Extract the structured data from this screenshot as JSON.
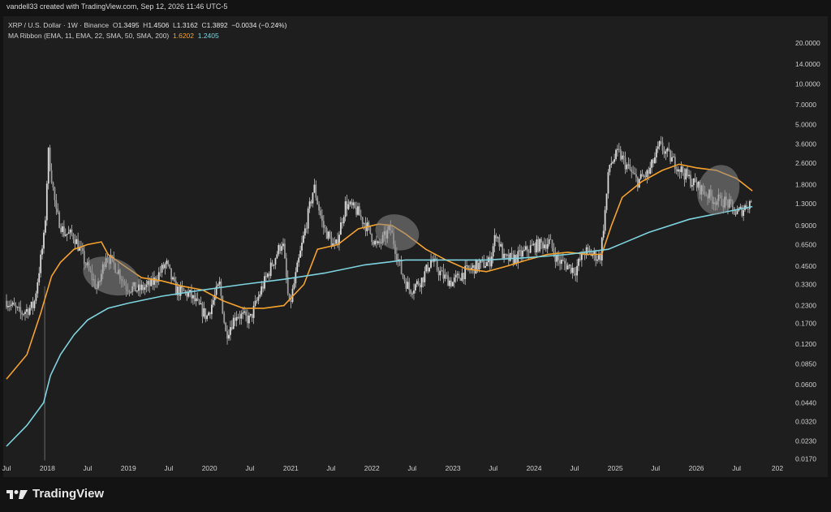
{
  "header": "vandell33 created with TradingView.com, Sep 12, 2026 11:46 UTC-5",
  "legend": {
    "symbol": "XRP / U.S. Dollar · 1W · Binance",
    "open_label": "O",
    "open": "1.3495",
    "high_label": "H",
    "high": "1.4506",
    "low_label": "L",
    "low": "1.3162",
    "close_label": "C",
    "close": "1.3892",
    "change": "−0.0034 (−0.24%)",
    "indicator": "MA Ribbon (EMA, 11, EMA, 22, SMA, 50, SMA, 200)",
    "ma1_value": "1.6202",
    "ma2_value": "1.2405"
  },
  "brand": "TradingView",
  "colors": {
    "ma_fast": "#f5a22d",
    "ma_slow": "#7ed3df",
    "candles": "#d9d9d9",
    "ellipse": "#8a8a8a"
  },
  "chart_data": {
    "type": "candlestick",
    "y_scale": "log",
    "ylim": [
      0.0155,
      24
    ],
    "y_ticks": [
      "20.0000",
      "14.0000",
      "10.0000",
      "7.0000",
      "5.0000",
      "3.6000",
      "2.6000",
      "1.8000",
      "1.3000",
      "0.9000",
      "0.6500",
      "0.4500",
      "0.3300",
      "0.2300",
      "0.1700",
      "0.1200",
      "0.0850",
      "0.0600",
      "0.0440",
      "0.0320",
      "0.0230",
      "0.0170"
    ],
    "x_range": [
      "2017-07-01",
      "2027-01-01"
    ],
    "x_ticks": [
      {
        "label": "Jul",
        "date": "2017-07-01"
      },
      {
        "label": "2018",
        "date": "2018-01-01"
      },
      {
        "label": "Jul",
        "date": "2018-07-01"
      },
      {
        "label": "2019",
        "date": "2019-01-01"
      },
      {
        "label": "Jul",
        "date": "2019-07-01"
      },
      {
        "label": "2020",
        "date": "2020-01-01"
      },
      {
        "label": "Jul",
        "date": "2020-07-01"
      },
      {
        "label": "2021",
        "date": "2021-01-01"
      },
      {
        "label": "Jul",
        "date": "2021-07-01"
      },
      {
        "label": "2022",
        "date": "2022-01-01"
      },
      {
        "label": "Jul",
        "date": "2022-07-01"
      },
      {
        "label": "2023",
        "date": "2023-01-01"
      },
      {
        "label": "Jul",
        "date": "2023-07-01"
      },
      {
        "label": "2024",
        "date": "2024-01-01"
      },
      {
        "label": "Jul",
        "date": "2024-07-01"
      },
      {
        "label": "2025",
        "date": "2025-01-01"
      },
      {
        "label": "Jul",
        "date": "2025-07-01"
      },
      {
        "label": "2026",
        "date": "2026-01-01"
      },
      {
        "label": "Jul",
        "date": "2026-07-01"
      },
      {
        "label": "202",
        "date": "2027-01-01"
      }
    ],
    "price_path": [
      [
        "2017-07-01",
        0.25
      ],
      [
        "2017-09-01",
        0.2
      ],
      [
        "2017-11-01",
        0.23
      ],
      [
        "2017-12-20",
        0.8
      ],
      [
        "2018-01-05",
        3.2
      ],
      [
        "2018-02-10",
        1.1
      ],
      [
        "2018-03-15",
        0.8
      ],
      [
        "2018-05-01",
        0.75
      ],
      [
        "2018-06-15",
        0.5
      ],
      [
        "2018-08-15",
        0.3
      ],
      [
        "2018-09-22",
        0.55
      ],
      [
        "2018-11-15",
        0.42
      ],
      [
        "2018-12-20",
        0.32
      ],
      [
        "2019-02-15",
        0.3
      ],
      [
        "2019-04-15",
        0.33
      ],
      [
        "2019-06-20",
        0.47
      ],
      [
        "2019-08-01",
        0.3
      ],
      [
        "2019-10-01",
        0.28
      ],
      [
        "2019-12-20",
        0.19
      ],
      [
        "2020-02-15",
        0.33
      ],
      [
        "2020-03-15",
        0.14
      ],
      [
        "2020-05-01",
        0.2
      ],
      [
        "2020-07-01",
        0.18
      ],
      [
        "2020-08-20",
        0.3
      ],
      [
        "2020-11-25",
        0.7
      ],
      [
        "2020-12-25",
        0.22
      ],
      [
        "2021-02-01",
        0.45
      ],
      [
        "2021-04-15",
        1.75
      ],
      [
        "2021-05-25",
        0.9
      ],
      [
        "2021-07-20",
        0.6
      ],
      [
        "2021-09-05",
        1.3
      ],
      [
        "2021-10-25",
        1.15
      ],
      [
        "2021-12-15",
        0.85
      ],
      [
        "2022-01-25",
        0.62
      ],
      [
        "2022-03-25",
        0.85
      ],
      [
        "2022-05-15",
        0.4
      ],
      [
        "2022-06-20",
        0.3
      ],
      [
        "2022-08-15",
        0.36
      ],
      [
        "2022-09-25",
        0.5
      ],
      [
        "2022-11-15",
        0.38
      ],
      [
        "2022-12-30",
        0.34
      ],
      [
        "2023-02-15",
        0.4
      ],
      [
        "2023-05-01",
        0.46
      ],
      [
        "2023-06-15",
        0.48
      ],
      [
        "2023-07-15",
        0.8
      ],
      [
        "2023-08-20",
        0.5
      ],
      [
        "2023-10-15",
        0.52
      ],
      [
        "2023-12-20",
        0.62
      ],
      [
        "2024-03-10",
        0.68
      ],
      [
        "2024-04-15",
        0.5
      ],
      [
        "2024-07-05",
        0.42
      ],
      [
        "2024-08-15",
        0.58
      ],
      [
        "2024-10-25",
        0.52
      ],
      [
        "2024-11-15",
        1.1
      ],
      [
        "2024-12-05",
        2.5
      ],
      [
        "2025-01-15",
        3.1
      ],
      [
        "2025-02-20",
        2.5
      ],
      [
        "2025-04-10",
        1.9
      ],
      [
        "2025-06-01",
        2.2
      ],
      [
        "2025-07-20",
        3.5
      ],
      [
        "2025-09-01",
        2.9
      ],
      [
        "2025-10-15",
        2.4
      ],
      [
        "2025-12-10",
        1.9
      ],
      [
        "2026-02-05",
        1.6
      ],
      [
        "2026-03-20",
        1.4
      ],
      [
        "2026-05-15",
        1.35
      ],
      [
        "2026-07-01",
        1.1
      ],
      [
        "2026-08-01",
        1.2
      ],
      [
        "2026-09-10",
        1.39
      ]
    ],
    "series": [
      {
        "name": "EMA 11",
        "color": "#f5a22d",
        "points": [
          [
            "2017-07-01",
            0.066
          ],
          [
            "2017-10-01",
            0.1
          ],
          [
            "2017-12-01",
            0.2
          ],
          [
            "2018-01-20",
            0.38
          ],
          [
            "2018-03-01",
            0.48
          ],
          [
            "2018-05-01",
            0.6
          ],
          [
            "2018-07-01",
            0.65
          ],
          [
            "2018-09-01",
            0.68
          ],
          [
            "2018-10-01",
            0.55
          ],
          [
            "2018-12-15",
            0.45
          ],
          [
            "2019-03-01",
            0.37
          ],
          [
            "2019-06-01",
            0.35
          ],
          [
            "2019-09-01",
            0.32
          ],
          [
            "2019-12-01",
            0.3
          ],
          [
            "2020-03-01",
            0.25
          ],
          [
            "2020-06-01",
            0.22
          ],
          [
            "2020-09-01",
            0.22
          ],
          [
            "2020-12-01",
            0.23
          ],
          [
            "2021-03-01",
            0.33
          ],
          [
            "2021-05-01",
            0.6
          ],
          [
            "2021-08-01",
            0.65
          ],
          [
            "2021-11-01",
            0.85
          ],
          [
            "2022-02-01",
            0.92
          ],
          [
            "2022-04-01",
            0.9
          ],
          [
            "2022-06-01",
            0.78
          ],
          [
            "2022-09-01",
            0.6
          ],
          [
            "2022-12-01",
            0.5
          ],
          [
            "2023-03-01",
            0.43
          ],
          [
            "2023-06-01",
            0.41
          ],
          [
            "2023-09-01",
            0.45
          ],
          [
            "2023-12-01",
            0.5
          ],
          [
            "2024-03-01",
            0.55
          ],
          [
            "2024-06-01",
            0.57
          ],
          [
            "2024-09-01",
            0.55
          ],
          [
            "2024-11-01",
            0.55
          ],
          [
            "2024-12-15",
            0.9
          ],
          [
            "2025-02-01",
            1.45
          ],
          [
            "2025-05-01",
            1.9
          ],
          [
            "2025-08-01",
            2.3
          ],
          [
            "2025-10-15",
            2.55
          ],
          [
            "2026-01-01",
            2.4
          ],
          [
            "2026-04-01",
            2.3
          ],
          [
            "2026-07-01",
            2.0
          ],
          [
            "2026-09-10",
            1.62
          ]
        ]
      },
      {
        "name": "SMA 200",
        "color": "#7ed3df",
        "points": [
          [
            "2017-07-01",
            0.021
          ],
          [
            "2017-10-01",
            0.03
          ],
          [
            "2017-12-15",
            0.044
          ],
          [
            "2018-01-15",
            0.07
          ],
          [
            "2018-03-01",
            0.1
          ],
          [
            "2018-05-01",
            0.14
          ],
          [
            "2018-07-01",
            0.18
          ],
          [
            "2018-10-01",
            0.22
          ],
          [
            "2019-01-01",
            0.24
          ],
          [
            "2019-06-01",
            0.27
          ],
          [
            "2019-12-01",
            0.3
          ],
          [
            "2020-06-01",
            0.33
          ],
          [
            "2020-12-01",
            0.36
          ],
          [
            "2021-06-01",
            0.4
          ],
          [
            "2021-12-01",
            0.46
          ],
          [
            "2022-06-01",
            0.5
          ],
          [
            "2022-12-01",
            0.5
          ],
          [
            "2023-06-01",
            0.5
          ],
          [
            "2023-12-01",
            0.52
          ],
          [
            "2024-06-01",
            0.55
          ],
          [
            "2024-12-01",
            0.6
          ],
          [
            "2025-06-01",
            0.8
          ],
          [
            "2025-12-01",
            1.0
          ],
          [
            "2026-06-01",
            1.15
          ],
          [
            "2026-09-10",
            1.24
          ]
        ]
      }
    ],
    "annotations": [
      {
        "type": "ellipse",
        "center": [
          "2018-10-15",
          0.38
        ],
        "span_days": 260,
        "y_range": [
          0.28,
          0.52
        ],
        "angle": 18
      },
      {
        "type": "ellipse",
        "center": [
          "2022-04-25",
          0.8
        ],
        "span_days": 200,
        "y_range": [
          0.55,
          1.0
        ],
        "angle": 18
      },
      {
        "type": "ellipse",
        "center": [
          "2026-04-10",
          1.65
        ],
        "span_days": 185,
        "y_range": [
          1.1,
          2.6
        ],
        "angle": 20
      }
    ]
  }
}
